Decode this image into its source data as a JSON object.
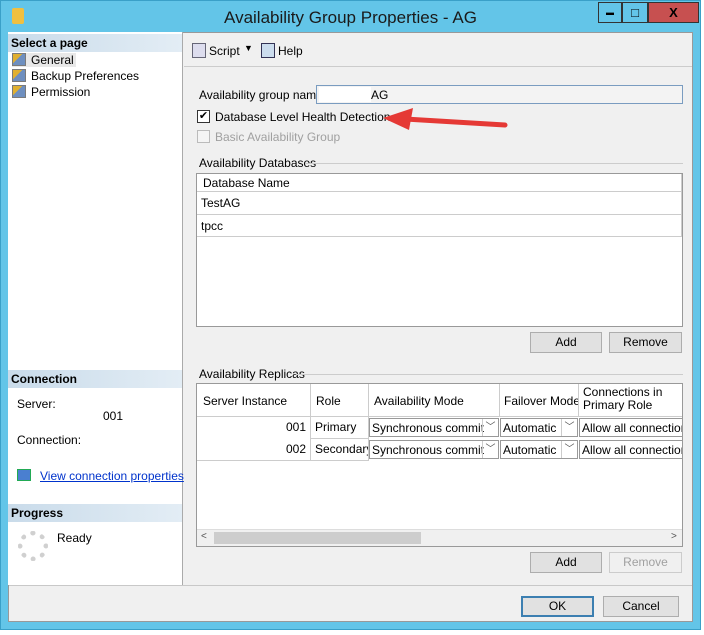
{
  "window": {
    "title": "Availability Group Properties -           AG",
    "minimize": "▬",
    "maximize": "□",
    "close": "X"
  },
  "sidebar": {
    "select_header": "Select a page",
    "items": [
      {
        "label": "General"
      },
      {
        "label": "Backup Preferences"
      },
      {
        "label": "Permission"
      }
    ],
    "connection_header": "Connection",
    "server_label": "Server:",
    "server_value": "001",
    "connection_label": "Connection:",
    "view_link": "View connection properties",
    "progress_header": "Progress",
    "progress_status": "Ready"
  },
  "toolbar": {
    "script": "Script",
    "help": "Help"
  },
  "general": {
    "ag_name_label": "Availability group name:",
    "ag_name_value": "AG",
    "db_health_label": "Database Level Health Detection",
    "db_health_checked": true,
    "basic_label": "Basic Availability Group",
    "basic_checked": false,
    "databases_header": "Availability Databases",
    "db_column": "Database Name",
    "databases": [
      "TestAG",
      "tpcc"
    ],
    "add": "Add",
    "remove": "Remove",
    "replicas_header": "Availability Replicas",
    "replica_columns": [
      "Server Instance",
      "Role",
      "Availability Mode",
      "Failover Mode",
      "Connections in Primary Role"
    ],
    "replicas": [
      {
        "instance": "001",
        "role": "Primary",
        "mode": "Synchronous commit",
        "failover": "Automatic",
        "conn": "Allow all connections"
      },
      {
        "instance": "002",
        "role": "Secondary",
        "mode": "Synchronous commit",
        "failover": "Automatic",
        "conn": "Allow all connections"
      }
    ],
    "add2": "Add",
    "remove2": "Remove"
  },
  "footer": {
    "ok": "OK",
    "cancel": "Cancel"
  },
  "colors": {
    "frame": "#63c5e8",
    "close": "#c75050",
    "arrow": "#e53935",
    "link": "#0033cc"
  }
}
